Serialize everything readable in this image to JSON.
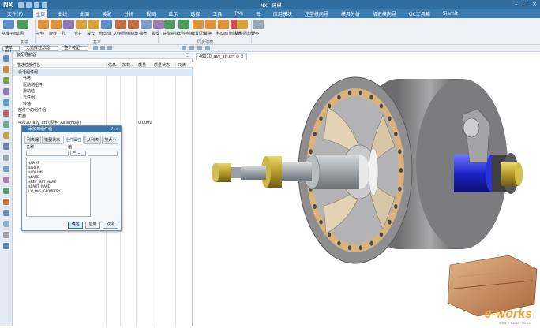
{
  "app": {
    "logo": "NX",
    "window_title": "NX - 建模"
  },
  "menu": [
    "文件(F)",
    "主页",
    "曲线",
    "曲面",
    "装配",
    "分析",
    "视图",
    "显示",
    "选择",
    "工具",
    "PMI",
    "云",
    "应用模块",
    "注塑模向导",
    "模具分析",
    "级进模向导",
    "GC工具箱",
    "Siemit"
  ],
  "ribbon": {
    "buttons": [
      "基准平面",
      "草图",
      "拉伸",
      "旋转",
      "孔",
      "合并",
      "减去",
      "修剪体",
      "边倒圆",
      "倒斜角",
      "抽壳",
      "拔模",
      "镜像特征",
      "阵列特征",
      "偏置区域",
      "替换",
      "移动面",
      "删除面",
      "调整圆角大小",
      "更多"
    ],
    "groups": [
      "构造",
      "基本",
      "同步建模"
    ]
  },
  "toolbar": {
    "filter_label": "菜单(M)",
    "selection_filter": "无选择过滤器",
    "scope": "整个装配"
  },
  "navigator": {
    "title": "装配导航器",
    "columns": [
      "描述性部件名",
      "信息",
      "加载...",
      "质量",
      "质量状态",
      "只读"
    ],
    "rows": [
      {
        "text": "会话组件组",
        "indent": 1
      },
      {
        "text": "外壳",
        "indent": 2
      },
      {
        "text": "驱动侧组件",
        "indent": 2
      },
      {
        "text": "滑动轴",
        "indent": 2
      },
      {
        "text": "元件组",
        "indent": 2
      },
      {
        "text": "转轴",
        "indent": 2
      },
      {
        "text": "部件中的组件组",
        "indent": 1
      },
      {
        "text": "截面",
        "indent": 1
      },
      {
        "text": "46010_asy_att (顺序: Assembly)",
        "indent": 1,
        "mass": "0.0000"
      }
    ]
  },
  "dialog": {
    "title": "添加到组件组",
    "help": "?",
    "close": "×",
    "tabs": [
      "列表器",
      "模型状态",
      "组件属性",
      "从列表",
      "按大小"
    ],
    "active_tab": 2,
    "name_label": "名称",
    "value_label": "值",
    "list_items": [
      "$MASS",
      "$AREA",
      "$VOLUME",
      "$NAME",
      "$REF_SET_NAME",
      "$PART_NAME",
      "LW_DWG_GEOMETRY"
    ],
    "buttons": [
      "确定",
      "应用",
      "取消"
    ]
  },
  "viewport": {
    "tab_label": "46010_asy_att.prt ⊙ ×"
  },
  "watermark": {
    "brand": "e-works",
    "site": "www.e-works.net.cn"
  }
}
